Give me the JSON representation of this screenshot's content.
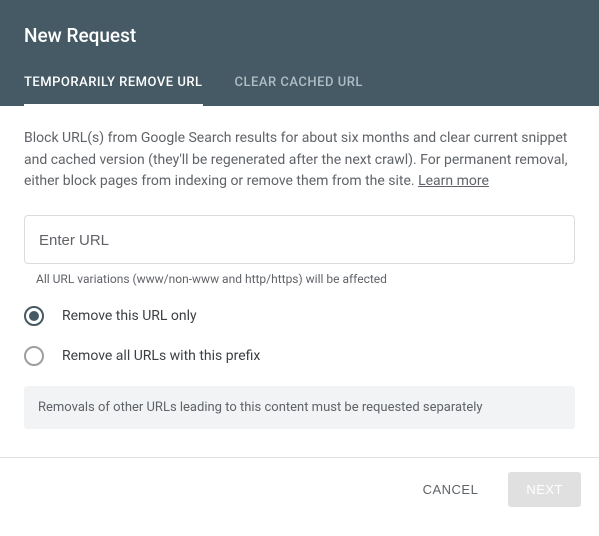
{
  "title": "New Request",
  "tabs": {
    "temporary": "TEMPORARILY REMOVE URL",
    "cached": "CLEAR CACHED URL"
  },
  "description": "Block URL(s) from Google Search results for about six months and clear current snippet and cached version (they'll be regenerated after the next crawl). For permanent removal, either block pages from indexing or remove them from the site. ",
  "learn_more": "Learn more",
  "url_input": {
    "placeholder": "Enter URL",
    "hint": "All URL variations (www/non-www and http/https) will be affected"
  },
  "radios": {
    "only": "Remove this URL only",
    "prefix": "Remove all URLs with this prefix"
  },
  "notice": "Removals of other URLs leading to this content must be requested separately",
  "buttons": {
    "cancel": "CANCEL",
    "next": "NEXT"
  }
}
